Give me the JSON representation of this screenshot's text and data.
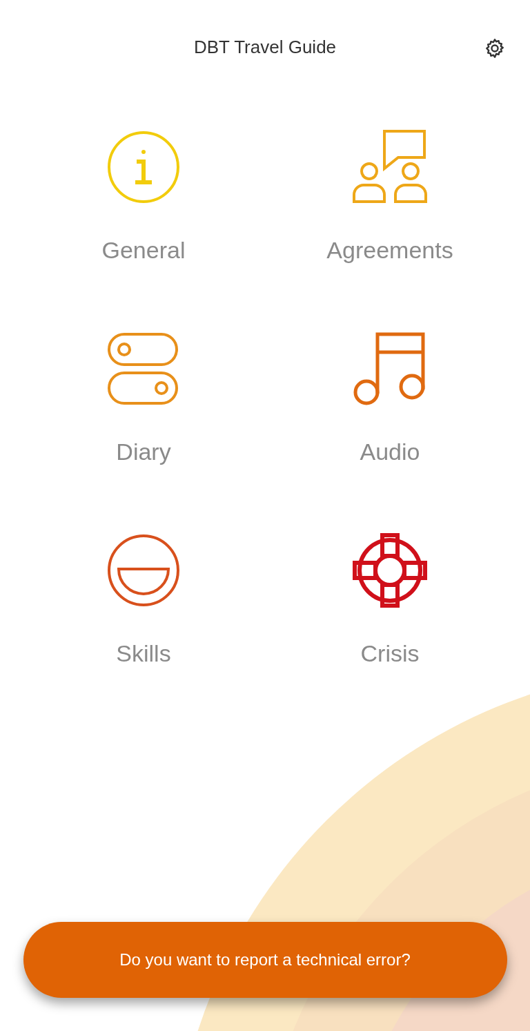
{
  "header": {
    "title": "DBT Travel Guide"
  },
  "tiles": [
    {
      "kind": "info",
      "label": "General",
      "color": "#f2cc0c"
    },
    {
      "kind": "people-chat",
      "label": "Agreements",
      "color": "#eea718"
    },
    {
      "kind": "toggles",
      "label": "Diary",
      "color": "#e8901a"
    },
    {
      "kind": "music",
      "label": "Audio",
      "color": "#e06a10"
    },
    {
      "kind": "smile",
      "label": "Skills",
      "color": "#d8501c"
    },
    {
      "kind": "lifebuoy",
      "label": "Crisis",
      "color": "#d0101a"
    }
  ],
  "report_button": {
    "label": "Do you want to report a technical error?"
  }
}
